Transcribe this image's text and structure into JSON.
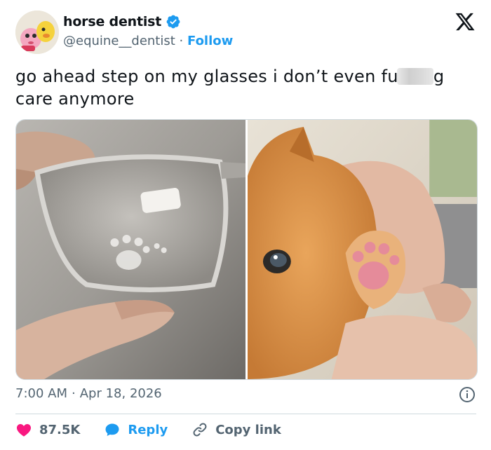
{
  "author": {
    "display_name": "horse dentist",
    "handle": "@equine__dentist",
    "separator": "·",
    "follow_label": "Follow"
  },
  "tweet": {
    "text_before": "go ahead step on my glasses i don’t even fu",
    "text_after": "g",
    "text_line2": "care anymore"
  },
  "meta": {
    "time": "7:00 AM",
    "separator": "·",
    "date": "Apr 18, 2026"
  },
  "actions": {
    "likes": "87.5K",
    "reply_label": "Reply",
    "copy_label": "Copy link"
  },
  "colors": {
    "accent": "#1d9bf0",
    "like": "#f91880",
    "muted": "#536471",
    "text": "#0f1419",
    "border": "#cfd9de"
  },
  "icons": [
    "avatar-image",
    "verified-badge-icon",
    "x-logo-icon",
    "info-icon",
    "heart-icon",
    "reply-bubble-icon",
    "link-icon"
  ]
}
